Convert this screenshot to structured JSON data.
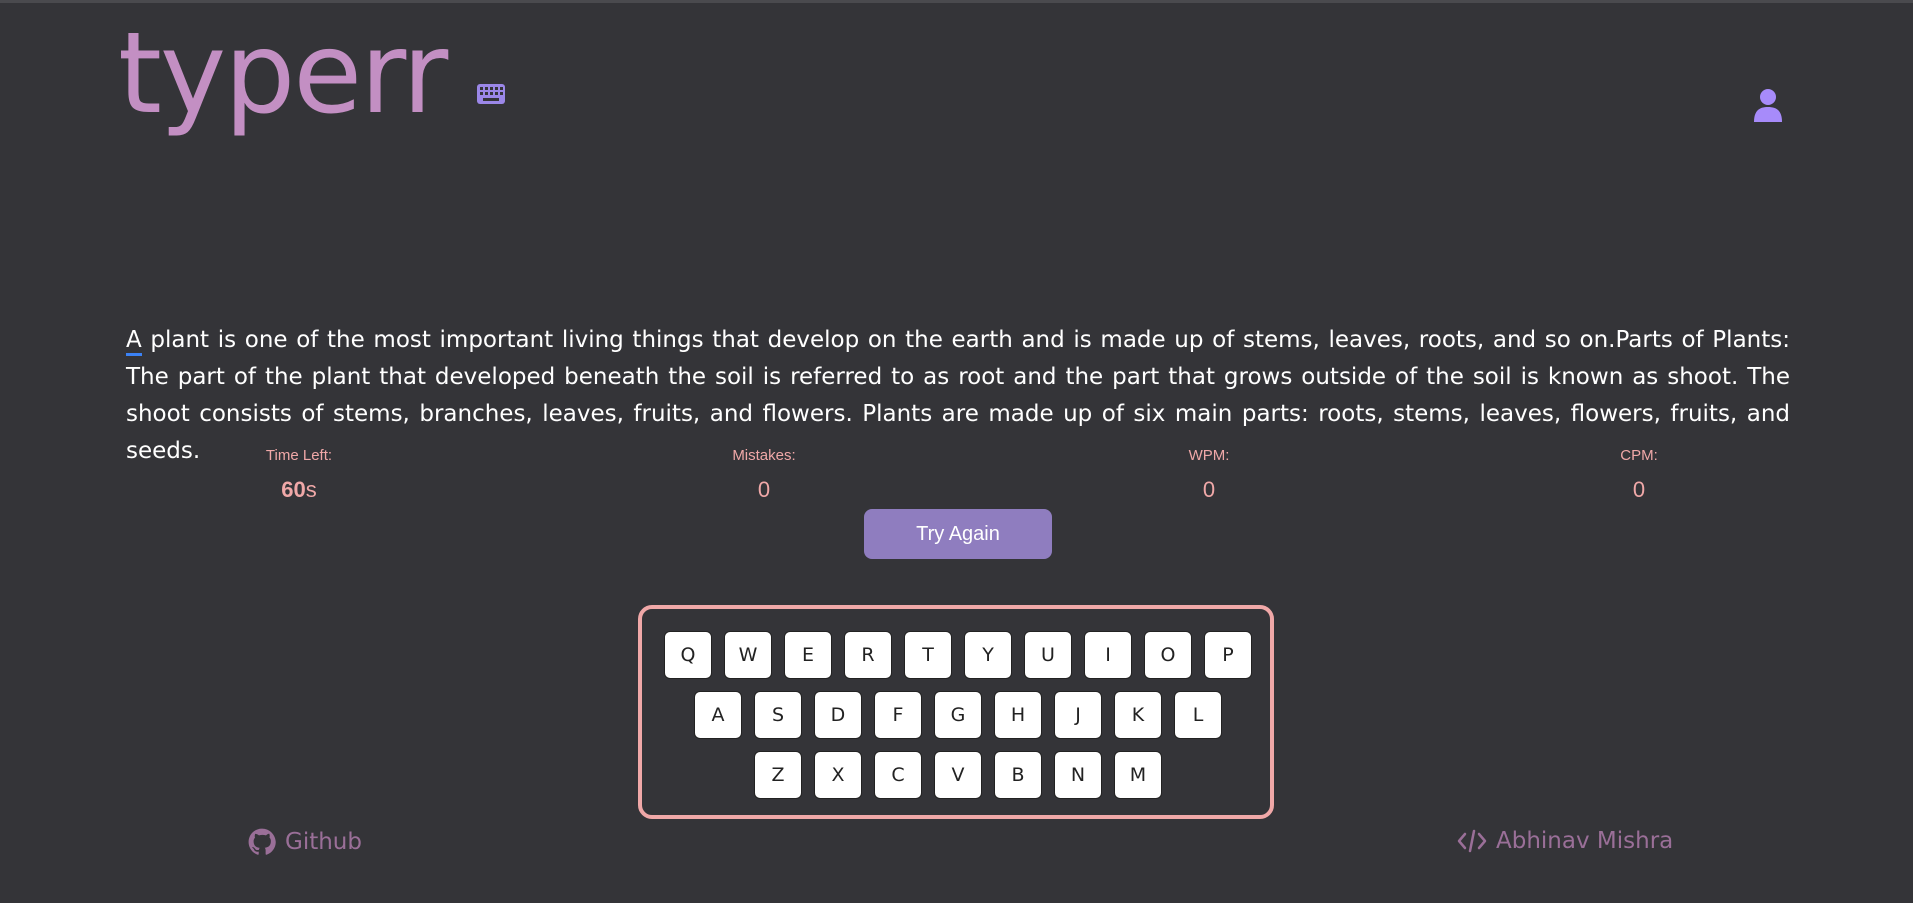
{
  "app": {
    "logo_text": "typerr",
    "logo_icon": "keyboard-icon",
    "user_icon": "user-icon",
    "accent_color": "#c38fc3",
    "stat_color": "#f0a8a8",
    "button_color": "#8f7dbf"
  },
  "passage": {
    "first_char": "A",
    "rest": " plant is one of the most important living things that develop on the earth and is made up of stems, leaves, roots, and so on.Parts of Plants: The part of the plant that developed beneath the soil is referred to as root and the part that grows outside of the soil is known as shoot. The shoot consists of stems, branches, leaves, fruits, and flowers. Plants are made up of six main parts: roots, stems, leaves, flowers, fruits, and seeds."
  },
  "stats": {
    "time_left_label": "Time Left:",
    "time_left_value": "60",
    "time_left_unit": "s",
    "mistakes_label": "Mistakes:",
    "mistakes_value": "0",
    "wpm_label": "WPM:",
    "wpm_value": "0",
    "cpm_label": "CPM:",
    "cpm_value": "0"
  },
  "try_again_label": "Try Again",
  "keyboard": {
    "row1": [
      "Q",
      "W",
      "E",
      "R",
      "T",
      "Y",
      "U",
      "I",
      "O",
      "P"
    ],
    "row2": [
      "A",
      "S",
      "D",
      "F",
      "G",
      "H",
      "J",
      "K",
      "L"
    ],
    "row3": [
      "Z",
      "X",
      "C",
      "V",
      "B",
      "N",
      "M"
    ]
  },
  "footer": {
    "github_label": "Github",
    "github_icon": "github-icon",
    "author_label": "Abhinav Mishra",
    "author_icon": "code-icon"
  }
}
